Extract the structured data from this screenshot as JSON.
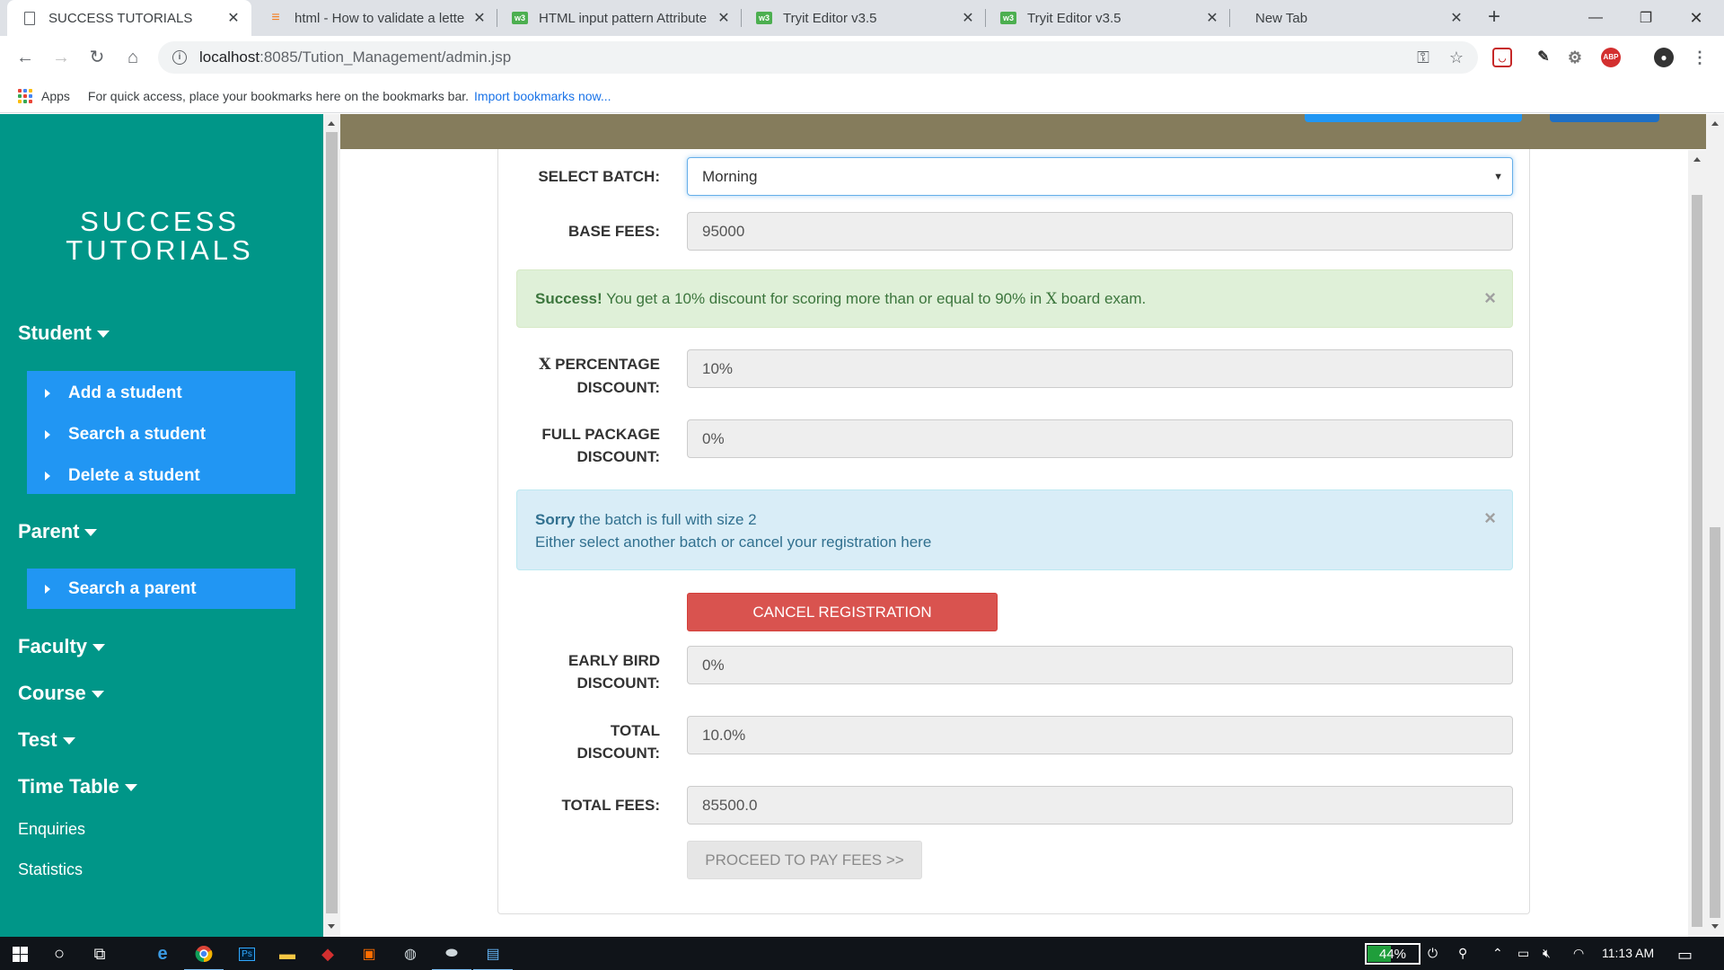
{
  "browser": {
    "tabs": [
      {
        "title": "SUCCESS TUTORIALS",
        "icon": "page-icon",
        "active": true
      },
      {
        "title": "html - How to validate a lette",
        "icon": "stackoverflow-icon",
        "active": false
      },
      {
        "title": "HTML input pattern Attribute",
        "icon": "w3schools-icon",
        "active": false
      },
      {
        "title": "Tryit Editor v3.5",
        "icon": "w3schools-icon",
        "active": false
      },
      {
        "title": "Tryit Editor v3.5",
        "icon": "w3schools-icon",
        "active": false
      },
      {
        "title": "New Tab",
        "icon": "none",
        "active": false
      }
    ],
    "w3_badge": "w3",
    "url_host": "localhost",
    "url_rest": ":8085/Tution_Management/admin.jsp",
    "bookmarks": {
      "apps_label": "Apps",
      "hint": "For quick access, place your bookmarks here on the bookmarks bar.",
      "import_link": "Import bookmarks now..."
    },
    "ext_abp": "ABP"
  },
  "sidebar": {
    "brand_line1": "SUCCESS",
    "brand_line2": "TUTORIALS",
    "student": {
      "label": "Student",
      "items": [
        "Add a student",
        "Search a student",
        "Delete a student"
      ]
    },
    "parent": {
      "label": "Parent",
      "items": [
        "Search a parent"
      ]
    },
    "faculty": "Faculty",
    "course": "Course",
    "test": "Test",
    "timetable": "Time Table",
    "enquiries": "Enquiries",
    "statistics": "Statistics"
  },
  "form": {
    "batch": {
      "label": "SELECT BATCH:",
      "value": "Morning"
    },
    "base_fees": {
      "label": "BASE FEES:",
      "value": "95000"
    },
    "success_alert": {
      "strong": "Success!",
      "text_before_x": " You get a 10% discount for scoring more than or equal to 90% in ",
      "x": "X",
      "text_after_x": " board exam.",
      "close": "×"
    },
    "x_discount": {
      "label_x": "X",
      "label_line1_rest": " PERCENTAGE",
      "label_line2": "DISCOUNT:",
      "value": "10%"
    },
    "full_package": {
      "label_line1": "FULL PACKAGE",
      "label_line2": "DISCOUNT:",
      "value": "0%"
    },
    "info_alert": {
      "strong": "Sorry",
      "line1_rest": " the batch is full with size 2",
      "line2": "Either select another batch or cancel your registration here",
      "close": "×"
    },
    "cancel_button": "CANCEL REGISTRATION",
    "early_bird": {
      "label_line1": "EARLY BIRD",
      "label_line2": "DISCOUNT:",
      "value": "0%"
    },
    "total_discount": {
      "label_line1": "TOTAL",
      "label_line2": "DISCOUNT:",
      "value": "10.0%"
    },
    "total_fees": {
      "label": "TOTAL FEES:",
      "value": "85500.0"
    },
    "proceed_button": "PROCEED TO PAY FEES >>"
  },
  "taskbar": {
    "battery": "44%",
    "battery_level": 0.44,
    "time": "11:13 AM"
  },
  "colors": {
    "sidebar": "#009688",
    "submenu": "#2196F3",
    "topbar": "#857c5c",
    "cancel": "#d9534f"
  }
}
